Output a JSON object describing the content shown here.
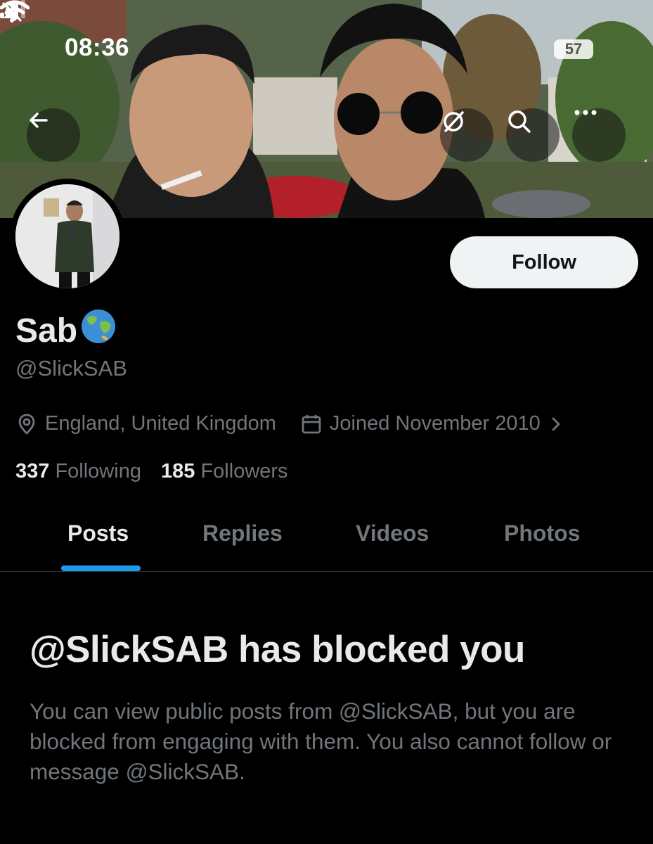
{
  "status_bar": {
    "time": "08:36",
    "battery": "57"
  },
  "profile": {
    "display_name": "Sab",
    "name_emoji": "🌏",
    "handle": "@SlickSAB",
    "location": "England, United Kingdom",
    "joined": "Joined November 2010",
    "following_count": "337",
    "following_label": "Following",
    "followers_count": "185",
    "followers_label": "Followers"
  },
  "actions": {
    "follow_label": "Follow"
  },
  "tabs": [
    {
      "label": "Posts",
      "active": true
    },
    {
      "label": "Replies",
      "active": false
    },
    {
      "label": "Videos",
      "active": false
    },
    {
      "label": "Photos",
      "active": false
    }
  ],
  "blocked": {
    "title": "@SlickSAB has blocked you",
    "description": "You can view public posts from @SlickSAB, but you are blocked from engaging with them. You also cannot follow or message @SlickSAB."
  },
  "colors": {
    "accent": "#1d9bf0",
    "background": "#000000",
    "secondary_text": "#71767b"
  },
  "icons": [
    "back-arrow-icon",
    "grok-icon",
    "search-icon",
    "more-icon",
    "location-pin-icon",
    "calendar-icon",
    "chevron-right-icon",
    "bell-slash-icon",
    "signal-icon",
    "wifi-icon"
  ]
}
